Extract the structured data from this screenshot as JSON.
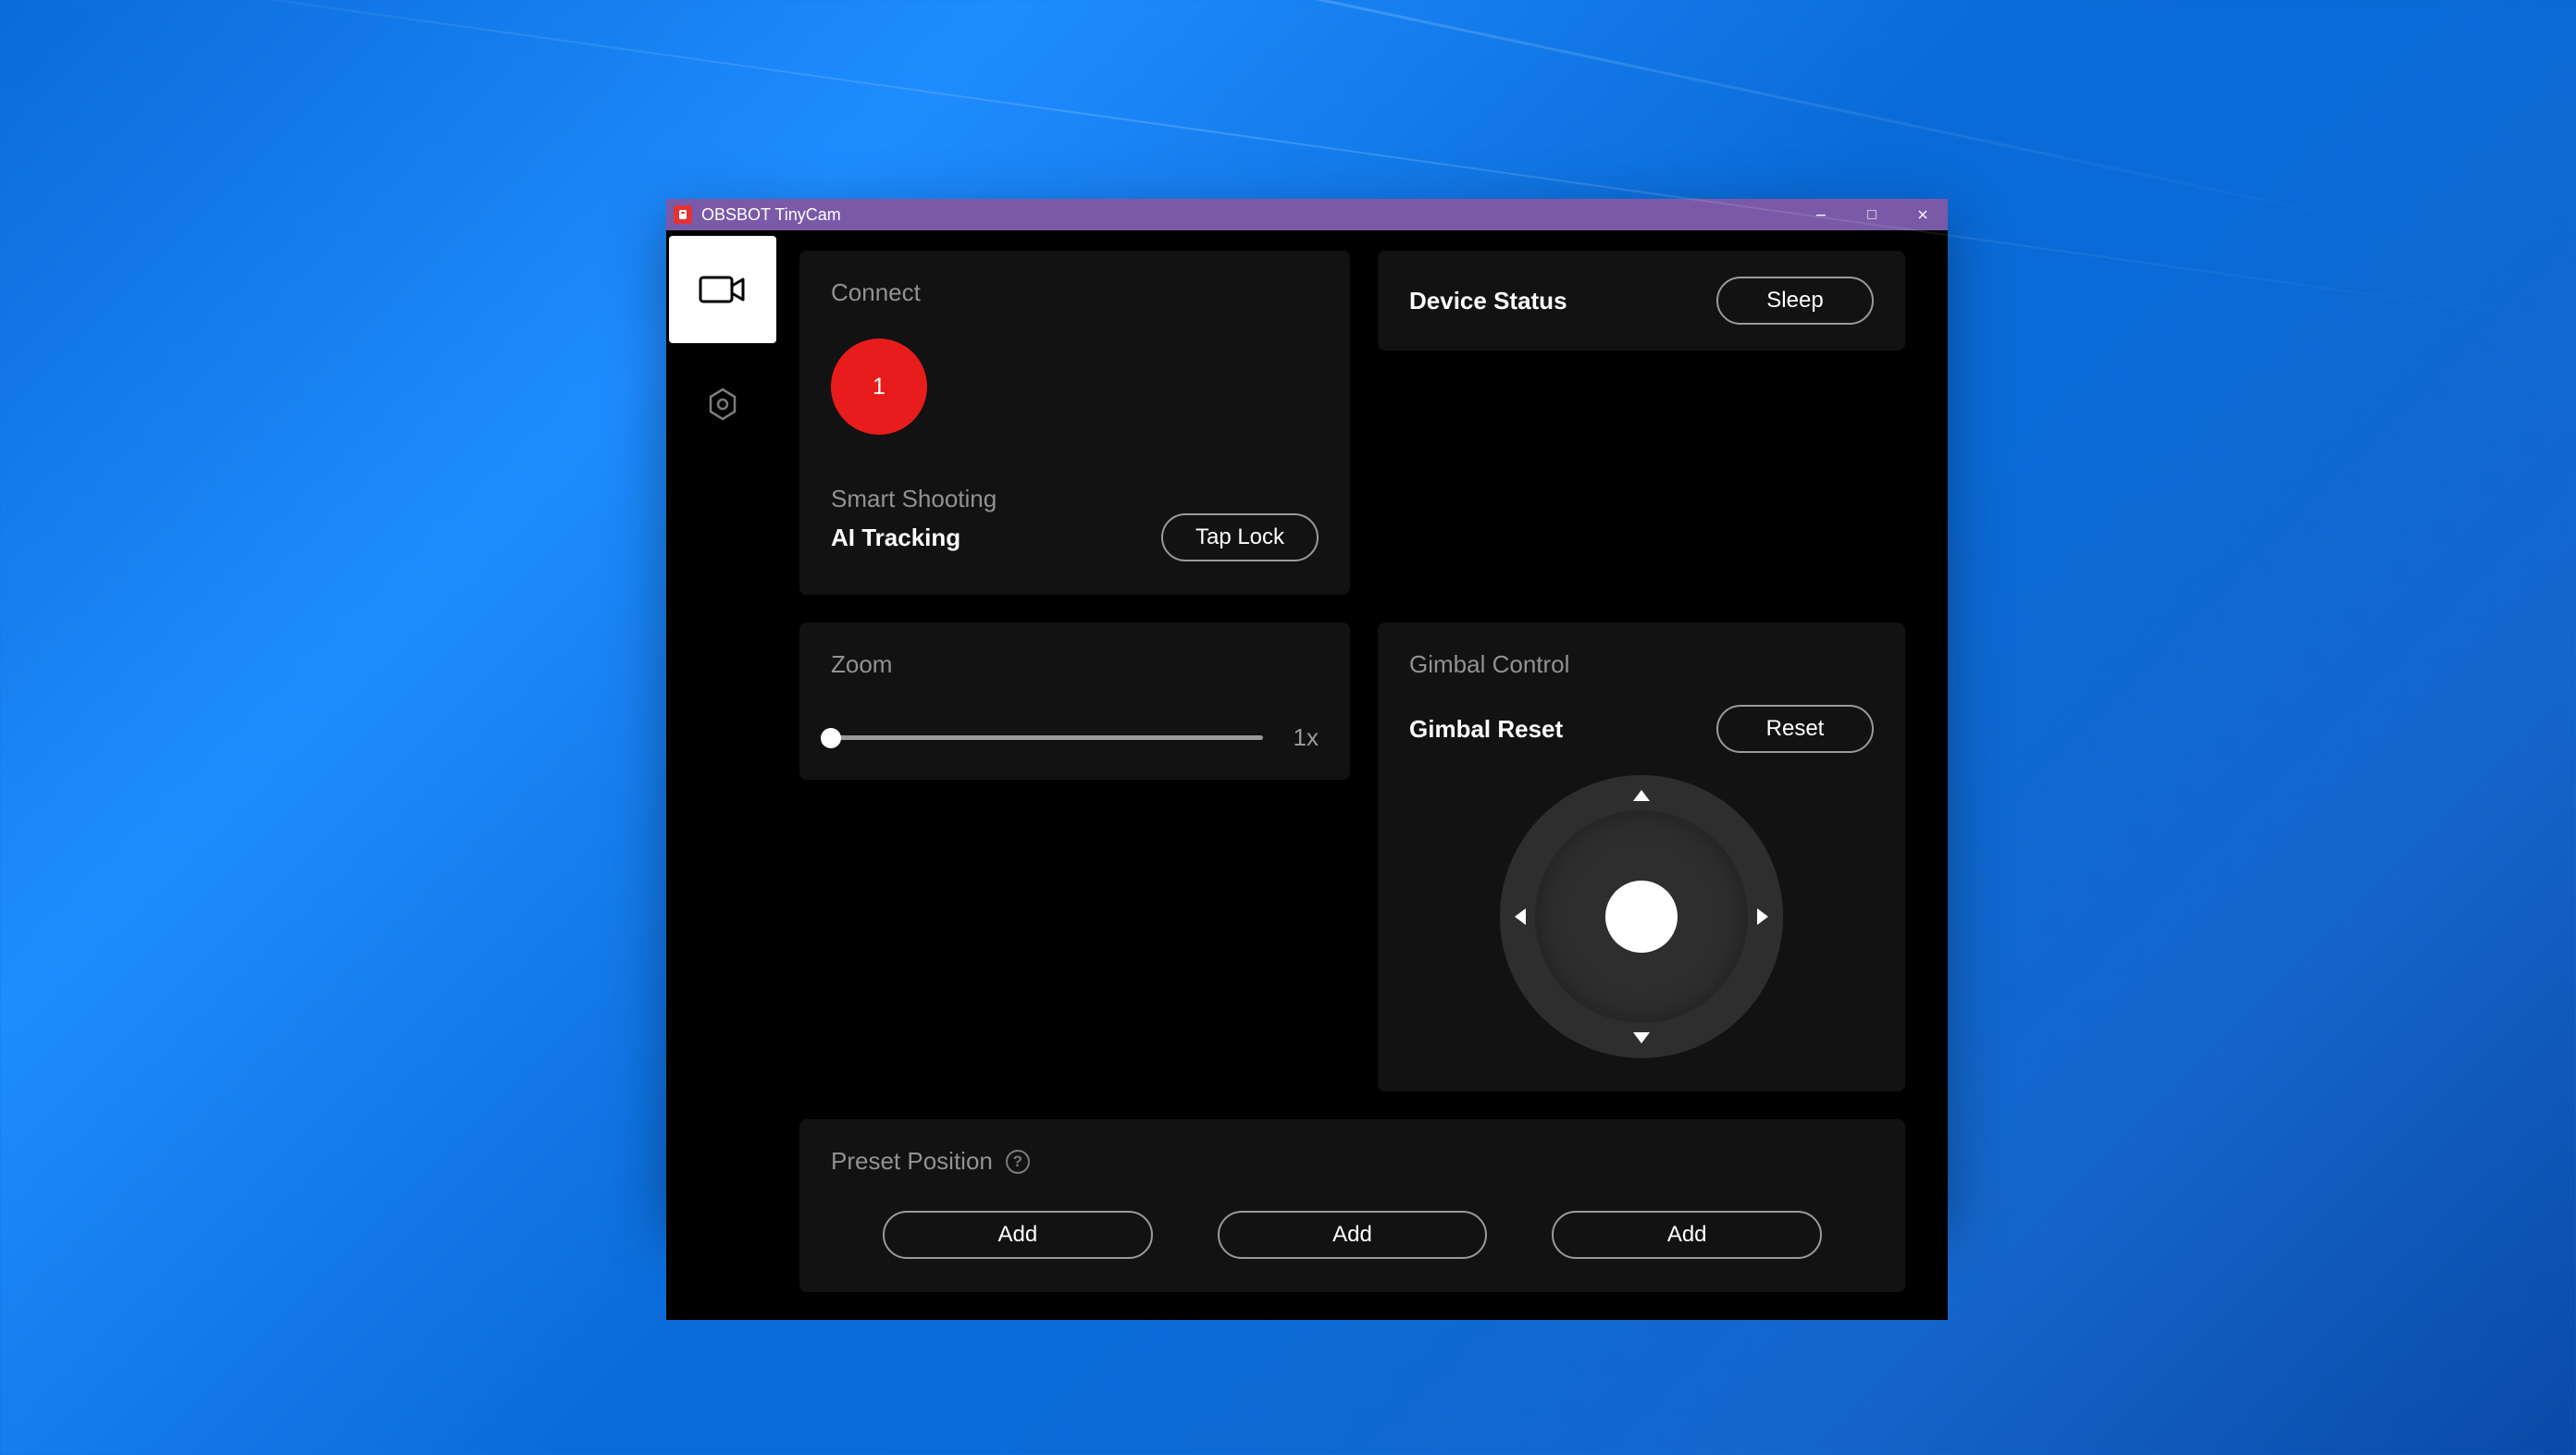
{
  "window": {
    "title": "OBSBOT TinyCam"
  },
  "connect": {
    "heading": "Connect",
    "device_number": "1",
    "smart_shooting_heading": "Smart Shooting",
    "ai_tracking_label": "AI Tracking",
    "tap_lock_label": "Tap Lock"
  },
  "device_status": {
    "label": "Device Status",
    "button": "Sleep"
  },
  "gimbal": {
    "heading": "Gimbal Control",
    "reset_label": "Gimbal Reset",
    "reset_button": "Reset"
  },
  "zoom": {
    "heading": "Zoom",
    "value": "1x",
    "slider_percent": 0
  },
  "preset": {
    "heading": "Preset Position",
    "help_glyph": "?",
    "buttons": [
      "Add",
      "Add",
      "Add"
    ]
  },
  "colors": {
    "accent": "#e81c1c",
    "titlebar": "#7a5aa8",
    "panel": "#121212"
  }
}
